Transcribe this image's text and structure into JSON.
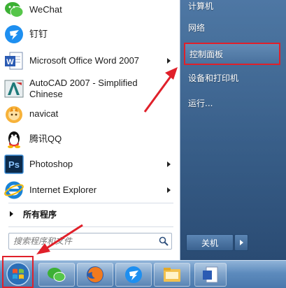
{
  "programs": [
    {
      "label": "WeChat",
      "icon": "wechat-icon",
      "has_arrow": false
    },
    {
      "label": "钉钉",
      "icon": "dingtalk-icon",
      "has_arrow": false
    },
    {
      "label": "Microsoft Office Word 2007",
      "icon": "word-icon",
      "has_arrow": true
    },
    {
      "label": "AutoCAD 2007 - Simplified Chinese",
      "icon": "autocad-icon",
      "has_arrow": false
    },
    {
      "label": "navicat",
      "icon": "navicat-icon",
      "has_arrow": false
    },
    {
      "label": "腾讯QQ",
      "icon": "qq-icon",
      "has_arrow": false
    },
    {
      "label": "Photoshop",
      "icon": "photoshop-icon",
      "has_arrow": true
    },
    {
      "label": "Internet Explorer",
      "icon": "ie-icon",
      "has_arrow": true
    }
  ],
  "all_programs_label": "所有程序",
  "search": {
    "placeholder": "搜索程序和文件"
  },
  "right_links": [
    {
      "label": "计算机"
    },
    {
      "label": "网络"
    },
    {
      "label": "控制面板",
      "highlighted": true
    },
    {
      "label": "设备和打印机"
    },
    {
      "label": "运行..."
    }
  ],
  "shutdown": {
    "label": "关机"
  },
  "photoshop_icon_text": "Ps",
  "word_icon_text": "W",
  "colors": {
    "annotation_red": "#e0202a",
    "menu_blue": "#2f557f"
  }
}
